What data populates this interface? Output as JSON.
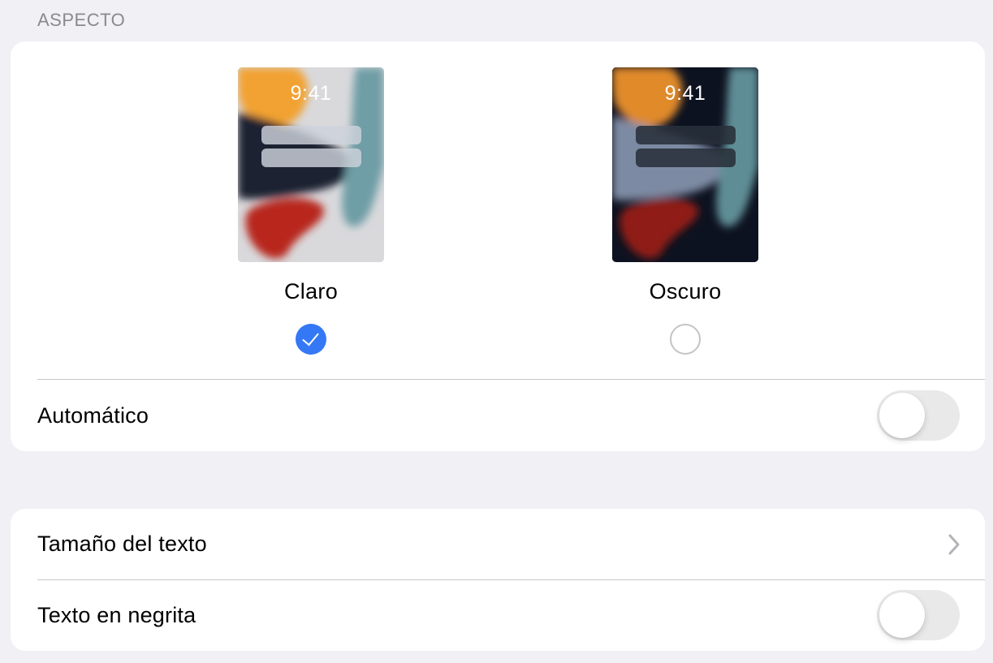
{
  "section": {
    "header": "ASPECTO"
  },
  "appearance": {
    "options": [
      {
        "label": "Claro",
        "preview_time": "9:41",
        "selected": true
      },
      {
        "label": "Oscuro",
        "preview_time": "9:41",
        "selected": false
      }
    ],
    "automatic": {
      "label": "Automático",
      "on": false
    }
  },
  "text_settings": {
    "text_size": {
      "label": "Tamaño del texto"
    },
    "bold_text": {
      "label": "Texto en negrita",
      "on": false
    }
  },
  "colors": {
    "background": "#f0f0f5",
    "card": "#ffffff",
    "accent": "#3478f6",
    "secondary_text": "#8a8a8e",
    "separator": "#c6c6c8",
    "toggle_off": "#e9e9ea"
  },
  "icons": {
    "selected_radio": "checkmark-circle-icon",
    "unselected_radio": "empty-circle-icon",
    "disclosure": "chevron-right-icon"
  }
}
